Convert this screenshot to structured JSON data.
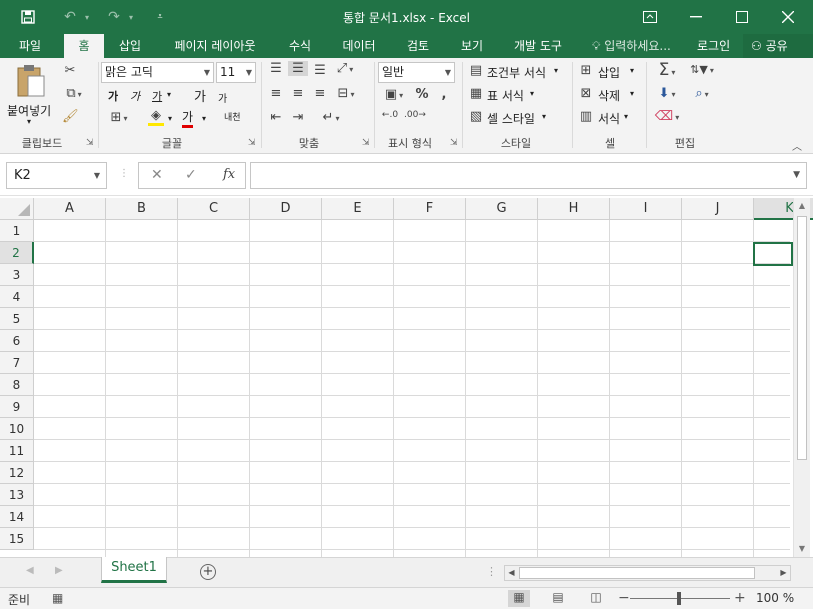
{
  "window": {
    "title": "통합 문서1.xlsx - Excel",
    "accent_color": "#217346"
  },
  "quick_access": {
    "save_icon": "save-icon",
    "undo_icon": "undo-icon",
    "redo_icon": "redo-icon",
    "customize_icon": "customize-qat-icon"
  },
  "tabs": [
    {
      "label": "파일"
    },
    {
      "label": "홈",
      "active": true
    },
    {
      "label": "삽입"
    },
    {
      "label": "페이지 레이아웃"
    },
    {
      "label": "수식"
    },
    {
      "label": "데이터"
    },
    {
      "label": "검토"
    },
    {
      "label": "보기"
    },
    {
      "label": "개발 도구"
    }
  ],
  "tell_me": "입력하세요...",
  "login": "로그인",
  "share": "공유",
  "ribbon": {
    "clipboard": {
      "paste_label": "붙여넣기",
      "group_label": "클립보드"
    },
    "font": {
      "font_name": "맑은 고딕",
      "font_size": "11",
      "bold": "가",
      "italic": "가",
      "underline": "가",
      "grow": "가",
      "shrink": "가",
      "font_color_glyph": "가",
      "phonetic": "내천",
      "group_label": "글꼴"
    },
    "alignment": {
      "group_label": "맞춤"
    },
    "number": {
      "format": "일반",
      "group_label": "표시 형식"
    },
    "styles": {
      "conditional": "조건부 서식",
      "format_table": "표 서식",
      "cell_styles": "셀 스타일",
      "group_label": "스타일"
    },
    "cells": {
      "insert": "삽입",
      "delete": "삭제",
      "format": "서식",
      "group_label": "셀"
    },
    "editing": {
      "group_label": "편집"
    }
  },
  "formula_bar": {
    "name_box": "K2",
    "fx": "fx",
    "value": ""
  },
  "grid": {
    "columns": [
      "A",
      "B",
      "C",
      "D",
      "E",
      "F",
      "G",
      "H",
      "I",
      "J",
      "K"
    ],
    "rows": [
      "1",
      "2",
      "3",
      "4",
      "5",
      "6",
      "7",
      "8",
      "9",
      "10",
      "11",
      "12",
      "13",
      "14",
      "15"
    ],
    "selected_column": "K",
    "selected_row": "2"
  },
  "sheets": [
    {
      "label": "Sheet1",
      "active": true
    }
  ],
  "status": {
    "ready": "준비",
    "zoom": "100 %"
  }
}
